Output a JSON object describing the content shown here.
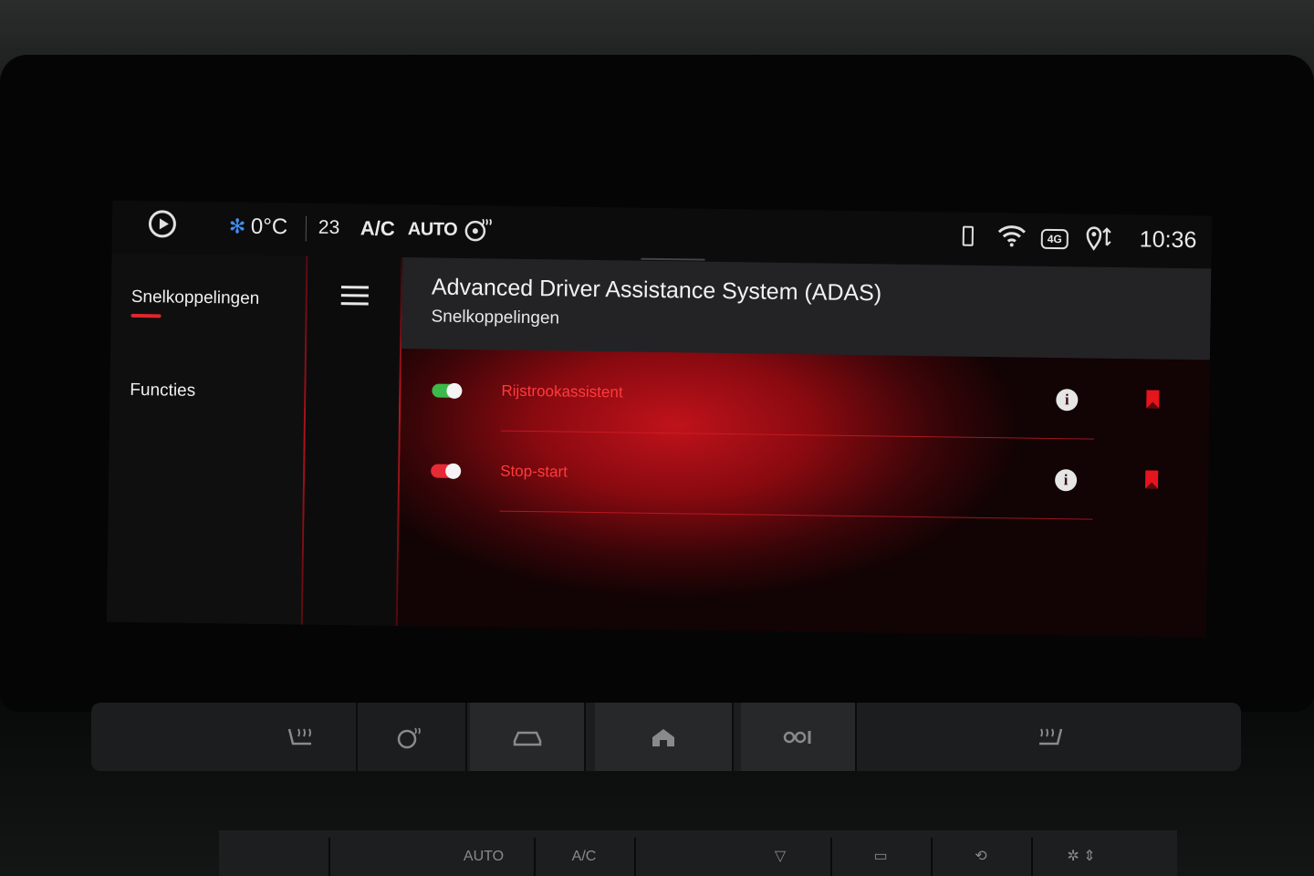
{
  "status_bar": {
    "outside_temp": "0°C",
    "fan_speed": "23",
    "ac_label": "A/C",
    "auto_label": "AUTO",
    "clock": "10:36",
    "network_label": "4G"
  },
  "sidebar": {
    "items": [
      {
        "label": "Snelkoppelingen",
        "selected": true
      },
      {
        "label": "Functies",
        "selected": false
      }
    ]
  },
  "header": {
    "title": "Advanced Driver Assistance System (ADAS)",
    "subtitle": "Snelkoppelingen"
  },
  "rows": [
    {
      "label": "Rijstrookassistent",
      "toggle_on": true,
      "toggle_color": "#3cb94b"
    },
    {
      "label": "Stop-start",
      "toggle_on": true,
      "toggle_color": "#e62b36"
    }
  ],
  "colors": {
    "accent": "#e0262c",
    "snow_icon": "#3f8ff2"
  },
  "physical_buttons": {
    "lower_ac_label": "A/C",
    "lower_auto_label": "AUTO"
  }
}
